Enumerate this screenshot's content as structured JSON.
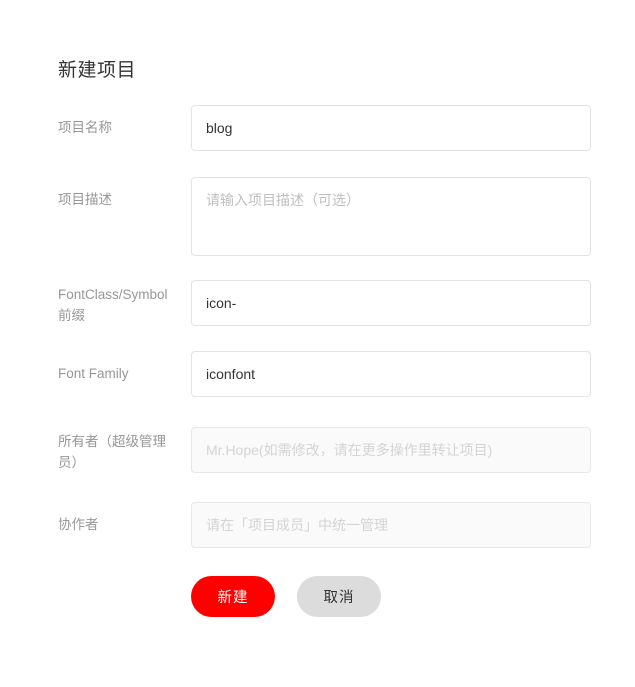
{
  "page": {
    "title": "新建项目"
  },
  "form": {
    "fields": [
      {
        "key": "project_name",
        "label": "项目名称",
        "value": "blog",
        "placeholder": "",
        "disabled": false,
        "type": "input"
      },
      {
        "key": "project_description",
        "label": "项目描述",
        "value": "",
        "placeholder": "请输入项目描述（可选）",
        "disabled": false,
        "type": "textarea"
      },
      {
        "key": "fontclass_symbol_prefix",
        "label": "FontClass/Symbol 前缀",
        "value": "icon-",
        "placeholder": "",
        "disabled": false,
        "type": "input"
      },
      {
        "key": "font_family",
        "label": "Font Family",
        "value": "iconfont",
        "placeholder": "",
        "disabled": false,
        "type": "input"
      },
      {
        "key": "owner",
        "label": "所有者（超级管理员）",
        "value": "",
        "placeholder": "Mr.Hope(如需修改，请在更多操作里转让项目)",
        "disabled": true,
        "type": "input"
      },
      {
        "key": "collaborators",
        "label": "协作者",
        "value": "",
        "placeholder": "请在「项目成员」中统一管理",
        "disabled": true,
        "type": "input"
      }
    ]
  },
  "actions": {
    "submit_label": "新建",
    "cancel_label": "取消"
  },
  "colors": {
    "primary": "#ff0000",
    "primary_text": "#ffffff",
    "secondary": "#dcdcdc",
    "secondary_text": "#333333",
    "label_text": "#979797",
    "input_border": "#e3e3e3",
    "disabled_background": "#fafafa",
    "placeholder_text": "#bfbfbf"
  }
}
